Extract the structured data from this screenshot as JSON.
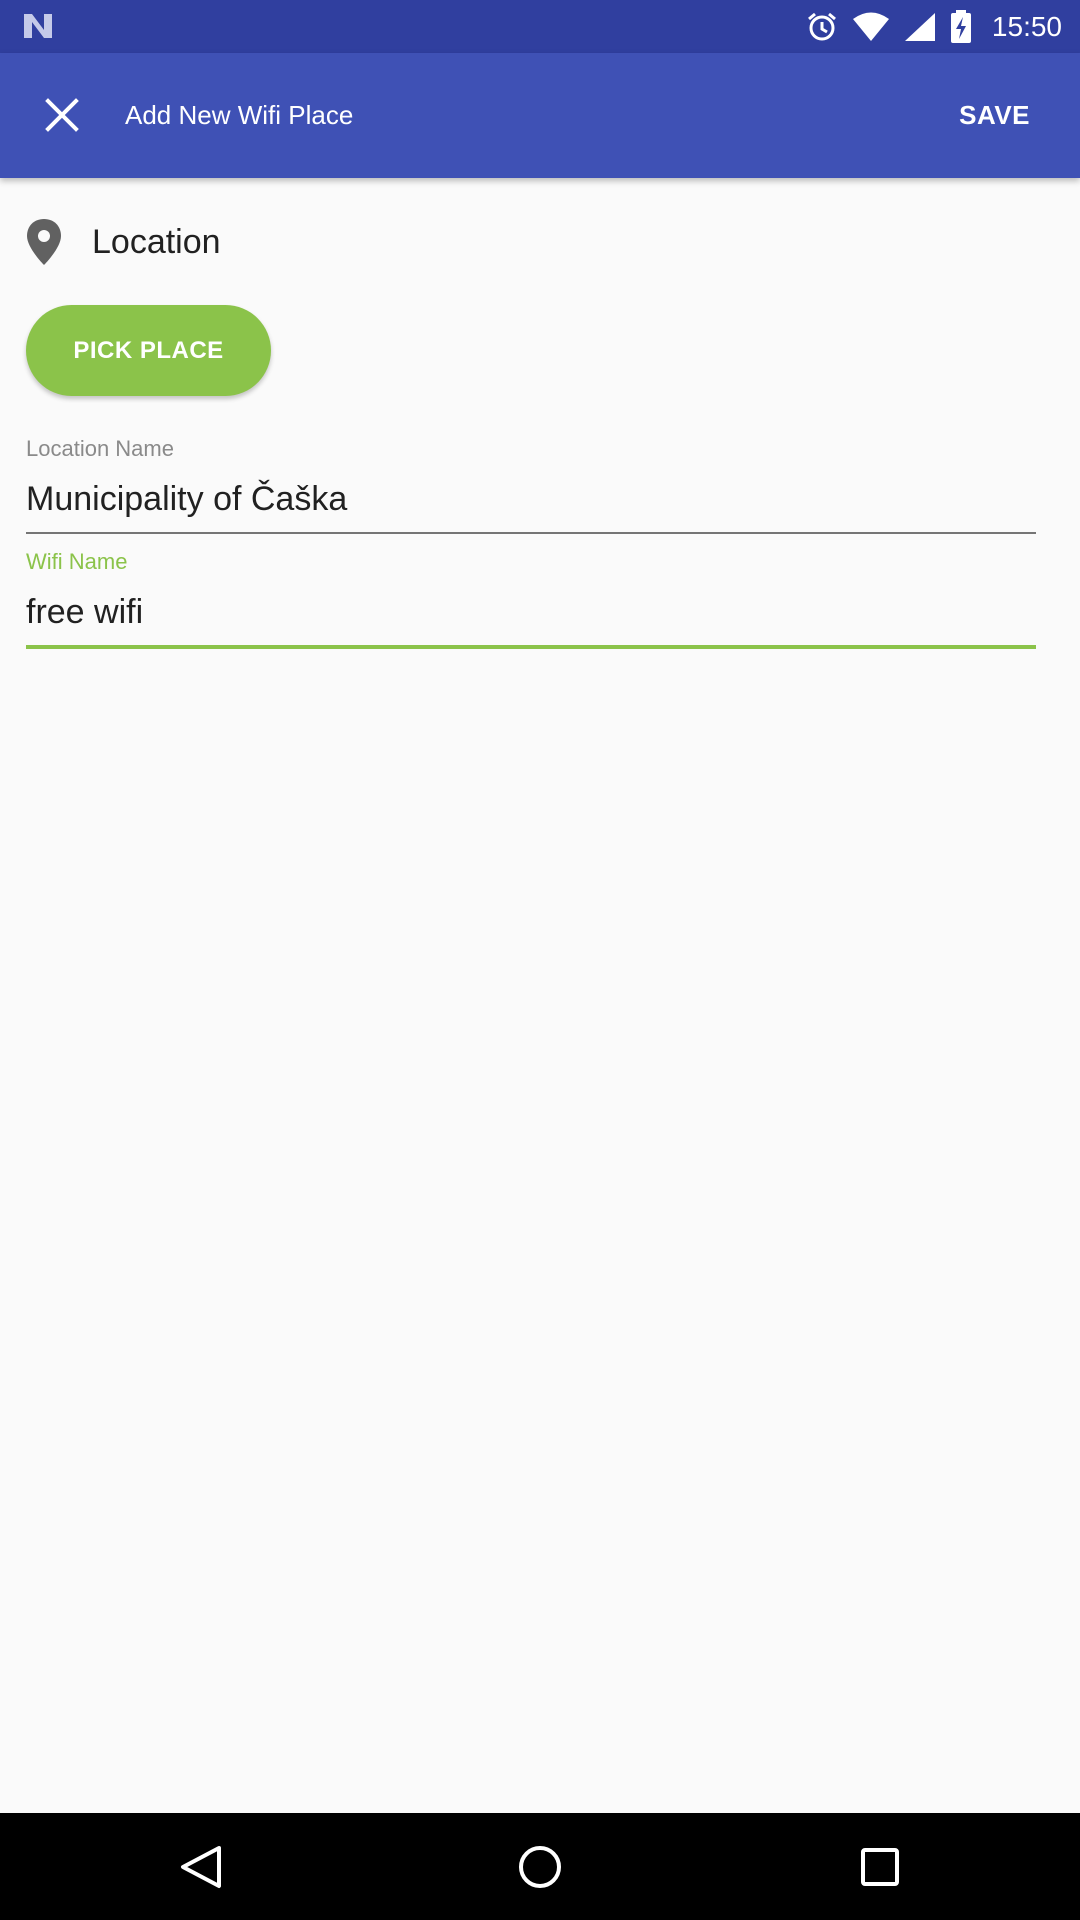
{
  "status_bar": {
    "time": "15:50",
    "icons": [
      "n-logo-icon",
      "alarm-icon",
      "wifi-icon",
      "cell-signal-icon",
      "battery-charging-icon"
    ]
  },
  "app_bar": {
    "title": "Add New Wifi Place",
    "close_icon": "close-icon",
    "save_label": "SAVE"
  },
  "location_section": {
    "icon": "location-pin-icon",
    "title": "Location",
    "pick_button_label": "PICK PLACE"
  },
  "fields": {
    "location_name": {
      "label": "Location Name",
      "value": "Municipality of Čaška"
    },
    "wifi_name": {
      "label": "Wifi Name",
      "value": "free wifi"
    }
  },
  "nav_bar": {
    "icons": [
      "back-icon",
      "home-icon",
      "recents-icon"
    ]
  },
  "colors": {
    "status_bar": "#303f9f",
    "app_bar": "#3f51b5",
    "accent": "#8bc34a",
    "background": "#fafafa"
  }
}
